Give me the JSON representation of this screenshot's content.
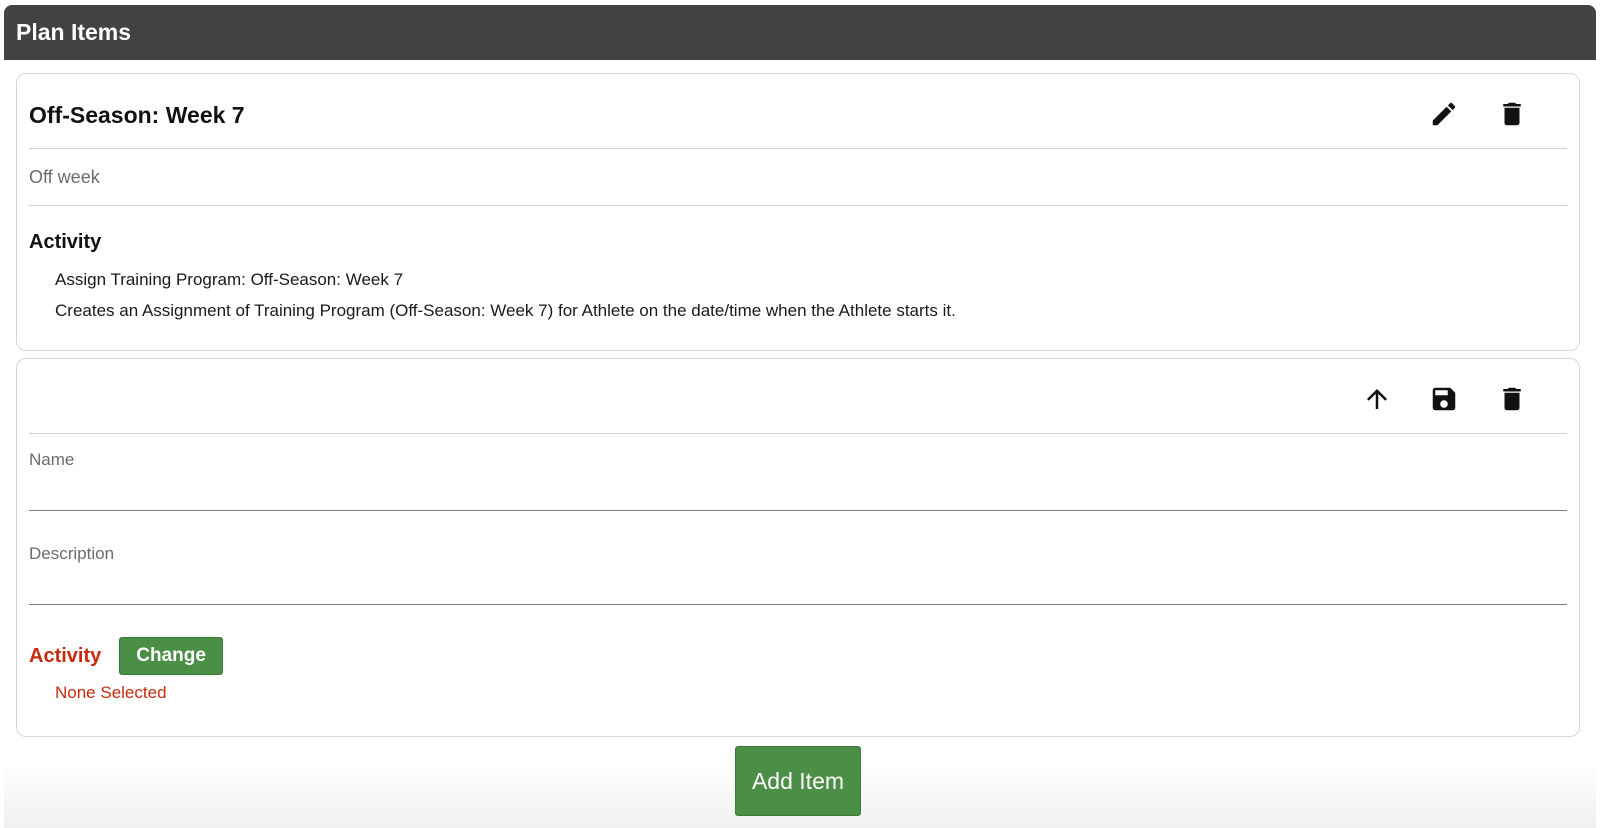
{
  "panel": {
    "title": "Plan Items"
  },
  "saved_item": {
    "title": "Off-Season: Week 7",
    "description": "Off week",
    "activity_heading": "Activity",
    "activity_lines": [
      "Assign Training Program: Off-Season: Week 7",
      "Creates an Assignment of Training Program (Off-Season: Week 7) for Athlete on the date/time when the Athlete starts it."
    ],
    "icons": [
      "edit-icon",
      "delete-icon"
    ]
  },
  "new_item": {
    "name_label": "Name",
    "name_value": "",
    "description_label": "Description",
    "description_value": "",
    "activity_label": "Activity",
    "change_label": "Change",
    "activity_value": "None Selected",
    "icons": [
      "arrow-up-icon",
      "save-icon",
      "delete-icon"
    ]
  },
  "footer": {
    "add_item_label": "Add Item"
  },
  "colors": {
    "header_bg": "#424242",
    "accent_green": "#4a8f45",
    "error_red": "#c62b0e"
  }
}
